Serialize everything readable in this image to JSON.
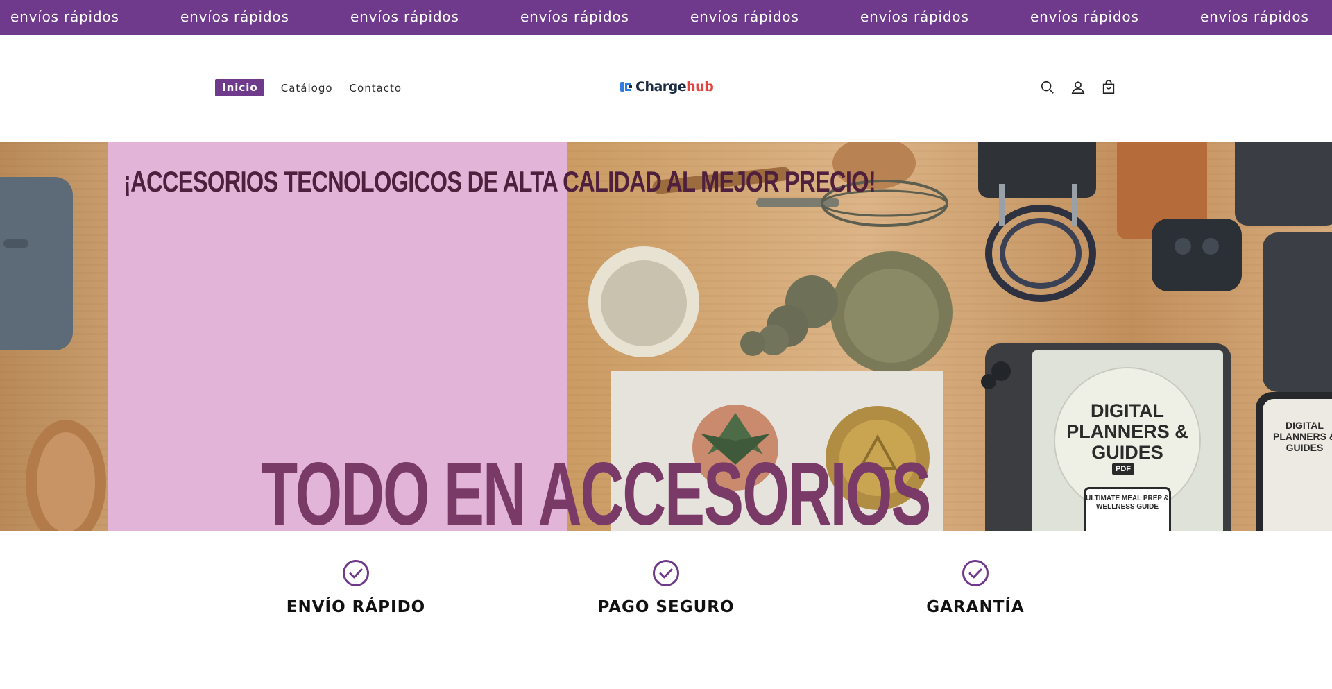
{
  "announcement": {
    "text": "envíos rápidos",
    "repeat_count": 8
  },
  "nav": {
    "items": [
      {
        "label": "Inicio",
        "active": true
      },
      {
        "label": "Catálogo",
        "active": false
      },
      {
        "label": "Contacto",
        "active": false
      }
    ]
  },
  "logo": {
    "text_dark": "Charge",
    "text_accent": "hub"
  },
  "header_icons": [
    "search-icon",
    "account-icon",
    "cart-icon"
  ],
  "hero": {
    "headline": "¡ACCESORIOS TECNOLOGICOS DE ALTA CALIDAD AL MEJOR PRECIO!",
    "tagline": "TODO EN ACCESORIOS",
    "tablet_text": "DIGITAL PLANNERS & GUIDES",
    "tablet_badge": "PDF",
    "tablet_subtext": "ULTIMATE MEAL PREP & WELLNESS GUIDE",
    "phone_text": "DIGITAL PLANNERS & GUIDES"
  },
  "features": [
    {
      "title": "ENVÍO RÁPIDO",
      "icon": "check-circle-icon"
    },
    {
      "title": "PAGO SEGURO",
      "icon": "check-circle-icon"
    },
    {
      "title": "GARANTÍA",
      "icon": "check-circle-icon"
    }
  ],
  "colors": {
    "brand_purple": "#6f3a8c",
    "hero_pink": "#e2b4d7",
    "logo_dark": "#1b2a45",
    "logo_accent": "#e0463f"
  }
}
